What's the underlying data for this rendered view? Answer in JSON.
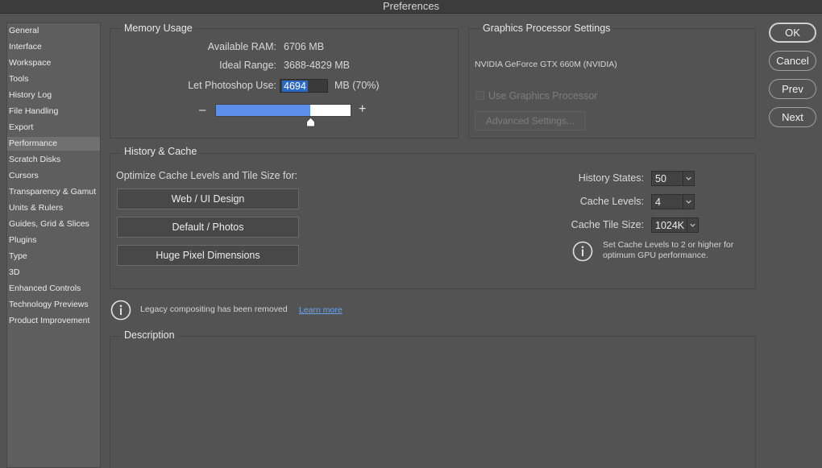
{
  "window": {
    "title": "Preferences"
  },
  "sidebar": {
    "items": [
      {
        "label": "General"
      },
      {
        "label": "Interface"
      },
      {
        "label": "Workspace"
      },
      {
        "label": "Tools"
      },
      {
        "label": "History Log"
      },
      {
        "label": "File Handling"
      },
      {
        "label": "Export"
      },
      {
        "label": "Performance",
        "selected": true
      },
      {
        "label": "Scratch Disks"
      },
      {
        "label": "Cursors"
      },
      {
        "label": "Transparency & Gamut"
      },
      {
        "label": "Units & Rulers"
      },
      {
        "label": "Guides, Grid & Slices"
      },
      {
        "label": "Plugins"
      },
      {
        "label": "Type"
      },
      {
        "label": "3D"
      },
      {
        "label": "Enhanced Controls"
      },
      {
        "label": "Technology Previews"
      },
      {
        "label": "Product Improvement"
      }
    ]
  },
  "memory": {
    "title": "Memory Usage",
    "available_label": "Available RAM:",
    "available_value": "6706 MB",
    "ideal_label": "Ideal Range:",
    "ideal_value": "3688-4829 MB",
    "use_label": "Let Photoshop Use:",
    "use_value": "4694",
    "use_suffix": "MB (70%)",
    "slider_minus": "–",
    "slider_plus": "+",
    "slider_fraction": 0.7
  },
  "gpu": {
    "title": "Graphics Processor Settings",
    "name": "NVIDIA GeForce GTX 660M (NVIDIA)",
    "use_gpu_label": "Use Graphics Processor",
    "use_gpu_checked": false,
    "advanced_label": "Advanced Settings..."
  },
  "history_cache": {
    "title": "History & Cache",
    "optimize_label": "Optimize Cache Levels and Tile Size for:",
    "buttons": [
      "Web / UI Design",
      "Default / Photos",
      "Huge Pixel Dimensions"
    ],
    "history_states_label": "History States:",
    "history_states_value": "50",
    "cache_levels_label": "Cache Levels:",
    "cache_levels_value": "4",
    "tile_size_label": "Cache Tile Size:",
    "tile_size_value": "1024K",
    "note_line1": "Set Cache Levels to 2 or higher for",
    "note_line2": "optimum GPU performance."
  },
  "legacy": {
    "message": "Legacy compositing has been removed",
    "link": "Learn more"
  },
  "description": {
    "title": "Description"
  },
  "dialog_buttons": {
    "ok": "OK",
    "cancel": "Cancel",
    "prev": "Prev",
    "next": "Next"
  },
  "colors": {
    "accent": "#2b69c7",
    "slider_fill": "#5b8fe8",
    "link": "#6aa6ef"
  }
}
